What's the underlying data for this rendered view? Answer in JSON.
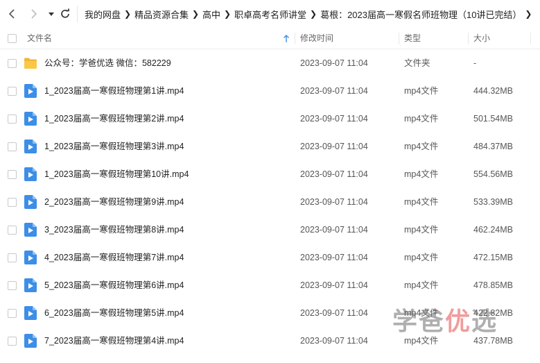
{
  "breadcrumb": [
    "我的网盘",
    "精品资源合集",
    "高中",
    "职卓高考名师讲堂",
    "葛根：2023届高一寒假名师班物理（10讲已完结）"
  ],
  "columns": {
    "name": "文件名",
    "date": "修改时间",
    "type": "类型",
    "size": "大小"
  },
  "files": [
    {
      "name": "公众号：学爸优选 微信：582229",
      "date": "2023-09-07 11:04",
      "type": "文件夹",
      "size": "-",
      "icon": "folder-icon"
    },
    {
      "name": "1_2023届高一寒假班物理第1讲.mp4",
      "date": "2023-09-07 11:04",
      "type": "mp4文件",
      "size": "444.32MB",
      "icon": "video-file-icon"
    },
    {
      "name": "1_2023届高一寒假班物理第2讲.mp4",
      "date": "2023-09-07 11:04",
      "type": "mp4文件",
      "size": "501.54MB",
      "icon": "video-file-icon"
    },
    {
      "name": "1_2023届高一寒假班物理第3讲.mp4",
      "date": "2023-09-07 11:04",
      "type": "mp4文件",
      "size": "484.37MB",
      "icon": "video-file-icon"
    },
    {
      "name": "1_2023届高一寒假班物理第10讲.mp4",
      "date": "2023-09-07 11:04",
      "type": "mp4文件",
      "size": "554.56MB",
      "icon": "video-file-icon"
    },
    {
      "name": "2_2023届高一寒假班物理第9讲.mp4",
      "date": "2023-09-07 11:04",
      "type": "mp4文件",
      "size": "533.39MB",
      "icon": "video-file-icon"
    },
    {
      "name": "3_2023届高一寒假班物理第8讲.mp4",
      "date": "2023-09-07 11:04",
      "type": "mp4文件",
      "size": "462.24MB",
      "icon": "video-file-icon"
    },
    {
      "name": "4_2023届高一寒假班物理第7讲.mp4",
      "date": "2023-09-07 11:04",
      "type": "mp4文件",
      "size": "472.15MB",
      "icon": "video-file-icon"
    },
    {
      "name": "5_2023届高一寒假班物理第6讲.mp4",
      "date": "2023-09-07 11:04",
      "type": "mp4文件",
      "size": "478.85MB",
      "icon": "video-file-icon"
    },
    {
      "name": "6_2023届高一寒假班物理第5讲.mp4",
      "date": "2023-09-07 11:04",
      "type": "mp4文件",
      "size": "422.82MB",
      "icon": "video-file-icon"
    },
    {
      "name": "7_2023届高一寒假班物理第4讲.mp4",
      "date": "2023-09-07 11:04",
      "type": "mp4文件",
      "size": "437.78MB",
      "icon": "video-file-icon"
    }
  ],
  "watermark": {
    "part1": "学爸",
    "part2": "优",
    "part3": "选"
  },
  "colors": {
    "folder": "#f8c13b",
    "video": "#3d8ee6",
    "sort_arrow": "#3d8ee6"
  }
}
